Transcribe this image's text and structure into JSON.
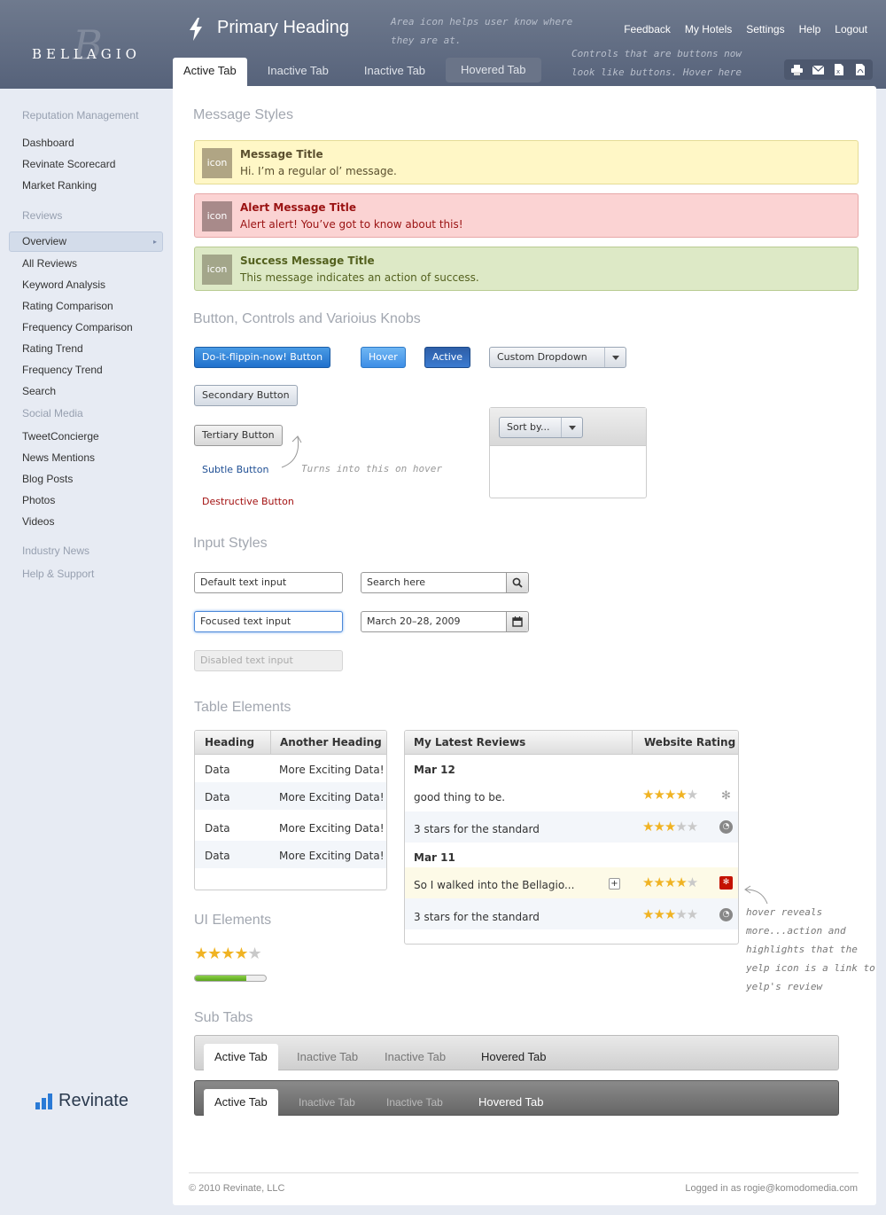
{
  "header": {
    "logo_text": "BELLAGIO",
    "logo_mark": "B",
    "primary_heading": "Primary Heading",
    "note_area": "Area icon helps user know where they are at.",
    "note_controls": "Controls that are buttons now look like buttons. Hover here",
    "util_links": [
      "Feedback",
      "My Hotels",
      "Settings",
      "Help",
      "Logout"
    ],
    "tabs": [
      {
        "label": "Active Tab",
        "state": "active"
      },
      {
        "label": "Inactive Tab",
        "state": "inactive"
      },
      {
        "label": "Inactive Tab",
        "state": "inactive"
      },
      {
        "label": "Hovered Tab",
        "state": "hovered"
      }
    ],
    "icon_buttons": [
      "print-icon",
      "email-icon",
      "excel-icon",
      "pdf-icon"
    ]
  },
  "sidebar": {
    "sections": [
      {
        "label": "Reputation Management",
        "items": [
          "Dashboard",
          "Revinate Scorecard",
          "Market Ranking"
        ]
      },
      {
        "label": "Reviews",
        "items": [
          "Overview",
          "All Reviews",
          "Keyword Analysis",
          "Rating Comparison",
          "Frequency Comparison",
          "Rating Trend",
          "Frequency Trend",
          "Search"
        ]
      },
      {
        "label": "Social Media",
        "items": [
          "TweetConcierge",
          "News Mentions",
          "Blog Posts",
          "Photos",
          "Videos"
        ]
      },
      {
        "label": "Industry News",
        "items": []
      },
      {
        "label": "Help & Support",
        "items": []
      }
    ],
    "active_item": "Overview",
    "brand": "Revinate"
  },
  "messages": {
    "section_title": "Message Styles",
    "icon_label": "icon",
    "info": {
      "title": "Message Title",
      "body": "Hi. I’m a regular ol’ message."
    },
    "alert": {
      "title": "Alert Message Title",
      "body": "Alert alert! You’ve got to know about this!"
    },
    "success": {
      "title": "Success Message Title",
      "body": "This message indicates an action of success."
    }
  },
  "buttons": {
    "section_title": "Button, Controls and Varioius Knobs",
    "primary": "Do-it-flippin-now! Button",
    "hover": "Hover",
    "active": "Active",
    "dropdown": "Custom Dropdown",
    "secondary": "Secondary Button",
    "tertiary": "Tertiary Button",
    "subtle": "Subtle Button",
    "destructive": "Destructive Button",
    "hover_note": "Turns into this on hover",
    "sort_dropdown": "Sort by..."
  },
  "inputs": {
    "section_title": "Input Styles",
    "default": "Default text input",
    "focused": "Focused text input",
    "disabled": "Disabled text input",
    "search_placeholder": "Search here",
    "date_value": "March 20–28, 2009"
  },
  "table": {
    "section_title": "Table Elements",
    "headers": [
      "Heading",
      "Another Heading"
    ],
    "rows": [
      [
        "Data",
        "More Exciting Data!"
      ],
      [
        "Data",
        "More Exciting Data!"
      ],
      [
        "Data",
        "More Exciting Data!"
      ],
      [
        "Data",
        "More Exciting Data!"
      ]
    ]
  },
  "reviews": {
    "headers": [
      "My Latest Reviews",
      "Website Rating"
    ],
    "groups": [
      {
        "date": "Mar 12",
        "items": [
          {
            "text": "good thing to be.",
            "rating": 4,
            "source": "yelp"
          },
          {
            "text": "3 stars for the standard",
            "rating": 3,
            "source": "generic"
          }
        ]
      },
      {
        "date": "Mar 11",
        "items": [
          {
            "text": "So I walked into the Bellagio...",
            "rating": 4,
            "source": "yelp-hover"
          },
          {
            "text": "3 stars for the standard",
            "rating": 3,
            "source": "generic"
          }
        ]
      }
    ],
    "hover_note": "hover reveals more...action and highlights that the yelp icon is a link to yelp's review"
  },
  "ui_elements": {
    "section_title": "UI Elements",
    "rating": 4,
    "rating_max": 5,
    "progress": 0.72
  },
  "subtabs": {
    "section_title": "Sub Tabs",
    "tabs": [
      "Active Tab",
      "Inactive Tab",
      "Inactive Tab",
      "Hovered Tab"
    ]
  },
  "footer": {
    "copyright": "© 2010 Revinate, LLC",
    "logged_in": "Logged in as rogie@komodomedia.com"
  },
  "colors": {
    "header_bg": "#616c82",
    "primary_button": "#2a7ad6",
    "info_bg": "#fff7c6",
    "alert_bg": "#fbd3d3",
    "success_bg": "#dde9c6",
    "star": "#f0b323"
  }
}
